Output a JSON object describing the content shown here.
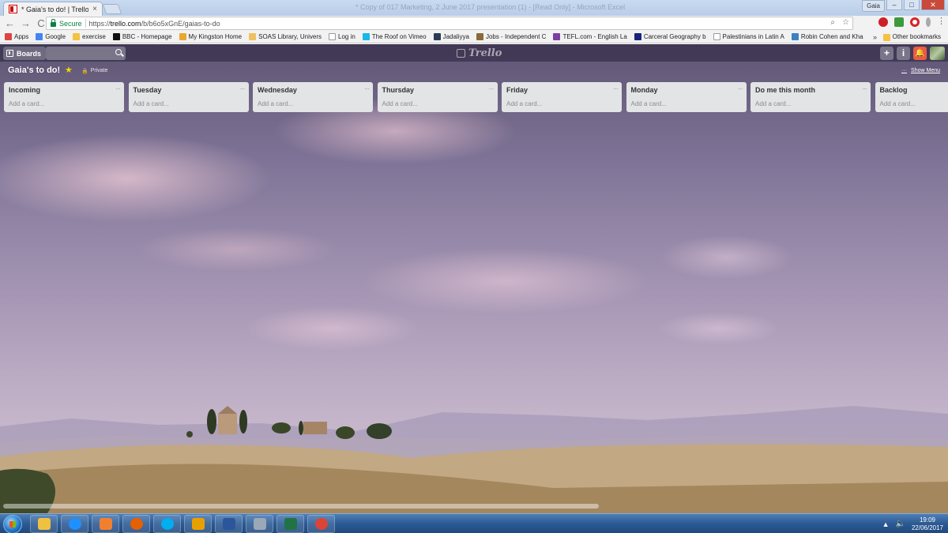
{
  "browser": {
    "tab_title": "* Gaia's to do! | Trello",
    "tab_close": "×",
    "window_title_faint": "* Copy of 017 Marketing, 2 June 2017 presentation (1) - [Read Only] - Microsoft Excel",
    "user_label": "Gaia",
    "win_min": "–",
    "win_max": "□",
    "win_close": "✕",
    "nav_back": "←",
    "nav_forward": "→",
    "nav_reload": "C",
    "secure_label": "Secure",
    "url_scheme": "https://",
    "url_host": "trello.com",
    "url_path": "/b/b6o5xGnE/gaias-to-do",
    "zoom_icon": "⌕",
    "bookmark_star": "☆",
    "menu_dots": "⋮",
    "bookmarks_more": "»",
    "other_bookmarks": "Other bookmarks",
    "bookmarks": [
      {
        "label": "Apps",
        "color": "#d44"
      },
      {
        "label": "Google",
        "color": "#4285f4"
      },
      {
        "label": "exercise",
        "color": "#f5c242"
      },
      {
        "label": "BBC - Homepage",
        "color": "#111"
      },
      {
        "label": "My Kingston Home",
        "color": "#e8a830"
      },
      {
        "label": "SOAS Library, Univers",
        "color": "#f0c060"
      },
      {
        "label": "Log in",
        "color": "#ffffff"
      },
      {
        "label": "The Roof on Vimeo",
        "color": "#1ab7ea"
      },
      {
        "label": "Jadaliyya",
        "color": "#2a3b55"
      },
      {
        "label": "Jobs - Independent C",
        "color": "#8a6a3a"
      },
      {
        "label": "TEFL.com - English La",
        "color": "#7b3fa0"
      },
      {
        "label": "Carceral Geography b",
        "color": "#1a237e"
      },
      {
        "label": "Palestinians in Latin A",
        "color": "#ffffff"
      },
      {
        "label": "Robin Cohen and Kha",
        "color": "#3b82c4"
      }
    ]
  },
  "trello": {
    "boards_label": "Boards",
    "logo_text": "Trello",
    "add_btn": "+",
    "info_btn": "i",
    "notif_btn": "🔔",
    "board_title": "Gaia's to do!",
    "star": "★",
    "visibility_icon": "🔒",
    "visibility_label": "Private",
    "show_menu_dots": "···",
    "show_menu": "Show Menu",
    "lists": [
      {
        "title": "Incoming",
        "add": "Add a card..."
      },
      {
        "title": "Tuesday",
        "add": "Add a card..."
      },
      {
        "title": "Wednesday",
        "add": "Add a card..."
      },
      {
        "title": "Thursday",
        "add": "Add a card..."
      },
      {
        "title": "Friday",
        "add": "Add a card..."
      },
      {
        "title": "Monday",
        "add": "Add a card..."
      },
      {
        "title": "Do me this month",
        "add": "Add a card..."
      },
      {
        "title": "Backlog",
        "add": "Add a card..."
      }
    ],
    "list_menu": "···"
  },
  "taskbar": {
    "items": [
      {
        "name": "explorer",
        "color": "#f0c040"
      },
      {
        "name": "internet-explorer",
        "color": "#1e90ff"
      },
      {
        "name": "media-player",
        "color": "#f08030"
      },
      {
        "name": "firefox",
        "color": "#e66000"
      },
      {
        "name": "skype",
        "color": "#00aff0"
      },
      {
        "name": "outlook",
        "color": "#e8a000"
      },
      {
        "name": "word",
        "color": "#2b579a"
      },
      {
        "name": "calculator",
        "color": "#9aa8b8"
      },
      {
        "name": "excel",
        "color": "#217346"
      },
      {
        "name": "chrome",
        "color": "#db4437"
      }
    ],
    "tray_arrow": "▲",
    "volume": "🔈",
    "time": "19:09",
    "date": "22/06/2017"
  }
}
